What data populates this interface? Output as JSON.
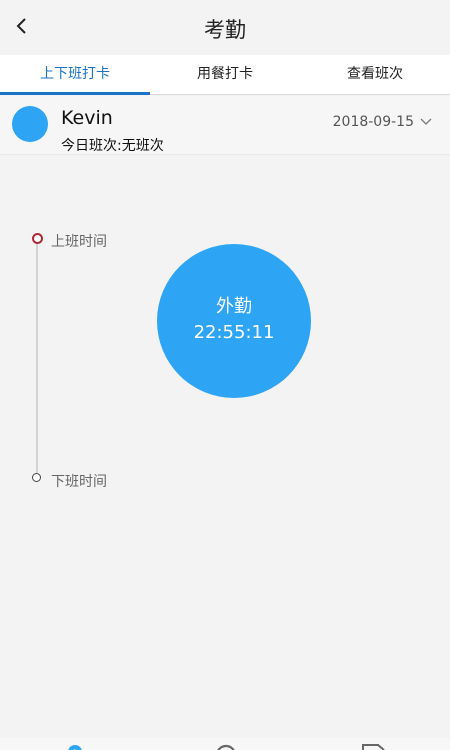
{
  "header": {
    "title": "考勤",
    "back_icon": "chevron-left-icon"
  },
  "tabs": [
    {
      "label": "上下班打卡",
      "active": true
    },
    {
      "label": "用餐打卡",
      "active": false
    },
    {
      "label": "查看班次",
      "active": false
    }
  ],
  "user": {
    "name": "Kevin",
    "shift": "今日班次:无班次",
    "date": "2018-09-15",
    "avatar_color": "#2ea4f5"
  },
  "timeline": {
    "start_label": "上班时间",
    "end_label": "下班时间"
  },
  "punch_button": {
    "type": "外勤",
    "time": "22:55:11",
    "color": "#2ea4f5"
  },
  "bottom_nav": {
    "icons": [
      "location-icon",
      "clock-icon",
      "document-icon"
    ]
  },
  "colors": {
    "accent": "#1a73c8",
    "timeline_start": "#b02a3a"
  }
}
